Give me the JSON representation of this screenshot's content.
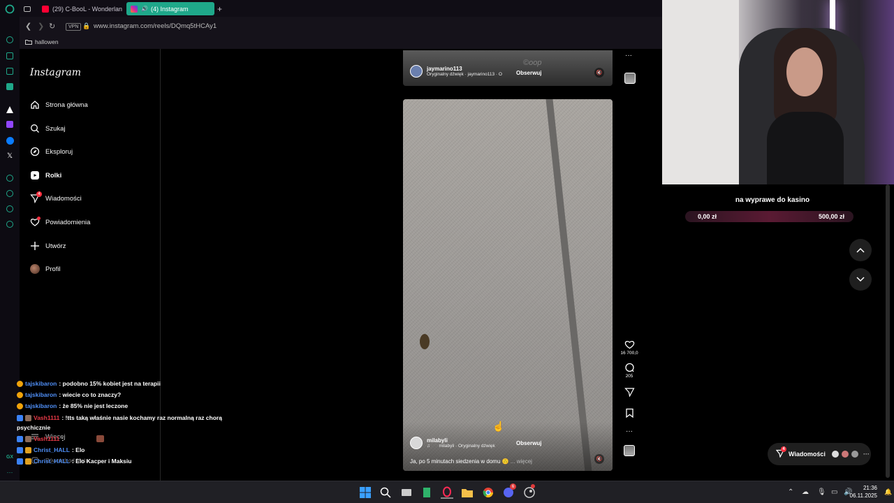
{
  "browser": {
    "tabs": [
      {
        "label": "(29) C-BooL - Wonderlan",
        "favicon_color": "#ff0033"
      },
      {
        "label": "(4) Instagram",
        "favicon_color": "#d6249f",
        "active": true
      }
    ],
    "vpn_label": "VPN",
    "url": "www.instagram.com/reels/DQmq5tHCAy1",
    "bookmark": "hallowen",
    "accent": "#1fa88a"
  },
  "instagram": {
    "logo": "Instagram",
    "nav": [
      {
        "label": "Strona główna",
        "icon": "home-icon"
      },
      {
        "label": "Szukaj",
        "icon": "search-icon"
      },
      {
        "label": "Eksploruj",
        "icon": "compass-icon"
      },
      {
        "label": "Rolki",
        "icon": "reels-icon",
        "active": true
      },
      {
        "label": "Wiadomości",
        "icon": "messenger-icon",
        "badge": "4"
      },
      {
        "label": "Powiadomienia",
        "icon": "heart-icon"
      },
      {
        "label": "Utwórz",
        "icon": "plus-icon"
      },
      {
        "label": "Profil",
        "icon": "avatar"
      }
    ],
    "more_label": "Więcej",
    "also_label": "Również od Meta",
    "reel_top": {
      "username": "jaymarino113",
      "audio": "Oryginalny dźwięk · jaymarino113 · O",
      "follow": "Obserwuj",
      "watermark": "©oop"
    },
    "reel_main": {
      "username": "milabyli",
      "audio": "milabyli · Oryginalny dźwięk",
      "follow": "Obserwuj",
      "caption": "Ja, po 5 minutach siedzenia w domu",
      "more": "... więcej"
    },
    "actions": {
      "likes": "16 700,0",
      "comments": "205"
    },
    "messages_pill": {
      "label": "Wiadomości",
      "badge": "4"
    }
  },
  "stream_overlay": {
    "goal_title": "na wyprawe do kasino",
    "goal_current": "0,00 zł",
    "goal_target": "500,00 zł",
    "chat": [
      {
        "user": "tajskibaron",
        "text": ": podobno 15% kobiet jest na terapii",
        "color": "#4f8ff7"
      },
      {
        "user": "tajskibaron",
        "text": ": wiecie co to znaczy?",
        "color": "#4f8ff7"
      },
      {
        "user": "tajskibaron",
        "text": ": że 85% nie jest leczone",
        "color": "#4f8ff7"
      },
      {
        "user": "Vash1111",
        "text": ": !tts taką właśnie nasie kochamy raz normalną raz chorą",
        "color": "#e63946"
      },
      {
        "user": "",
        "text": "psychicznie",
        "color": "#ffffff"
      },
      {
        "user": "Vash1111",
        "text": ":",
        "color": "#e63946"
      },
      {
        "user": "Christ_HALL",
        "text": ": Elo",
        "color": "#4f8ff7"
      },
      {
        "user": "Christ_HALL",
        "text": ": Elo Kacper i Maksiu",
        "color": "#4f8ff7"
      }
    ]
  },
  "taskbar": {
    "time": "21:36",
    "date": "06.11.2025",
    "discord_badge": "6"
  }
}
